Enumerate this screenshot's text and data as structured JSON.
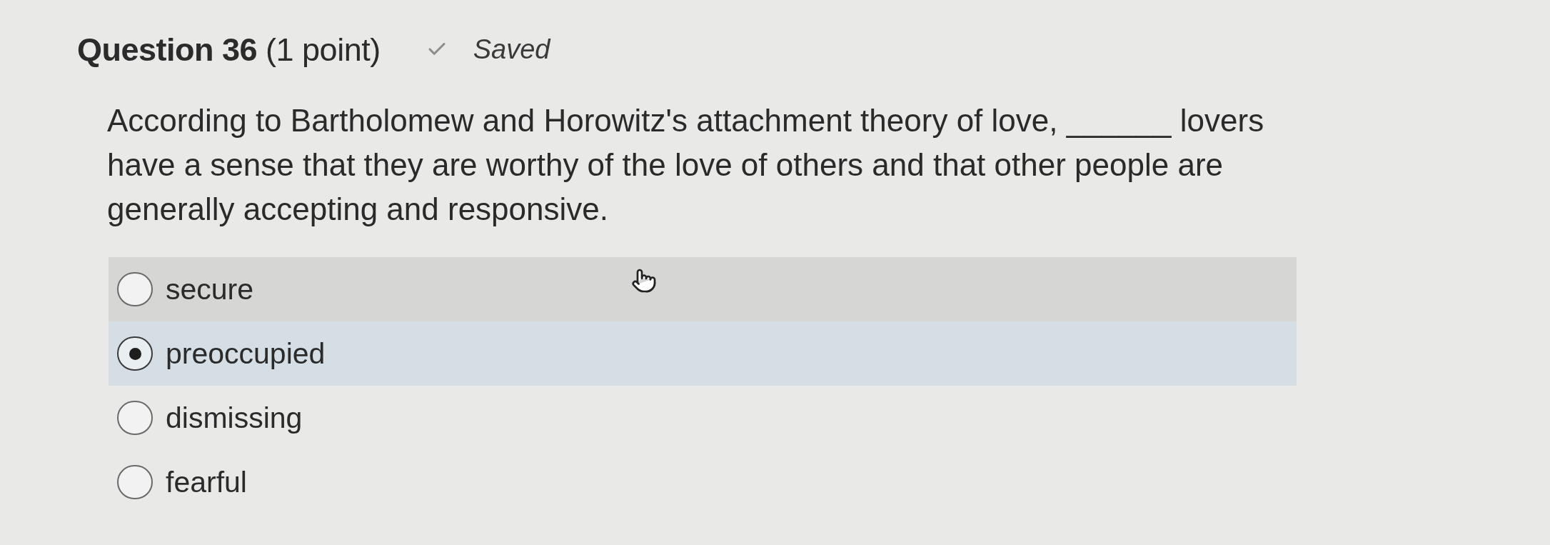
{
  "question": {
    "title": "Question 36",
    "points": "(1 point)",
    "save_status": {
      "kind": "saved",
      "label": "Saved"
    }
  },
  "prompt": "According to Bartholomew and Horowitz's attachment theory of love, ______ lovers have a sense that they are worthy of the love of others and that other people are generally accepting and responsive.",
  "options": [
    {
      "label": "secure",
      "selected": false,
      "hovered": true
    },
    {
      "label": "preoccupied",
      "selected": true,
      "hovered": false
    },
    {
      "label": "dismissing",
      "selected": false,
      "hovered": false
    },
    {
      "label": "fearful",
      "selected": false,
      "hovered": false
    }
  ]
}
